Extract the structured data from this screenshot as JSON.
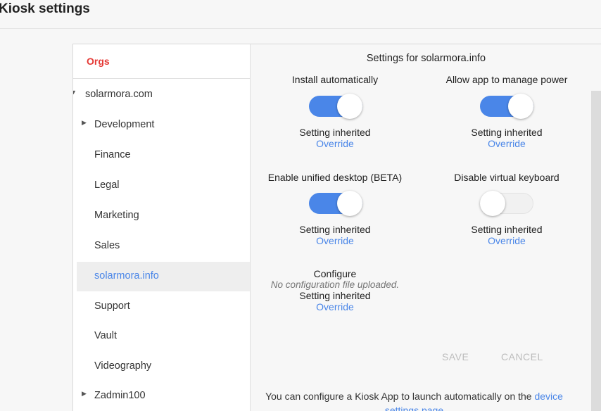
{
  "page": {
    "title": "Kiosk settings"
  },
  "sidebar": {
    "header": "Orgs",
    "items": [
      {
        "label": "solarmora.com",
        "arrow": "▼",
        "depth": 0
      },
      {
        "label": "Development",
        "arrow": "▶",
        "depth": 1
      },
      {
        "label": "Finance",
        "depth": 1
      },
      {
        "label": "Legal",
        "depth": 1
      },
      {
        "label": "Marketing",
        "depth": 1
      },
      {
        "label": "Sales",
        "depth": 1
      },
      {
        "label": "solarmora.info",
        "depth": 1,
        "selected": true
      },
      {
        "label": "Support",
        "depth": 1
      },
      {
        "label": "Vault",
        "depth": 1
      },
      {
        "label": "Videography",
        "depth": 1
      },
      {
        "label": "Zadmin100",
        "arrow": "▶",
        "depth": 1
      }
    ]
  },
  "main": {
    "title": "Settings for solarmora.info",
    "settings": [
      {
        "name": "Install automatically",
        "state": "on",
        "inherited": "Setting inherited",
        "override": "Override"
      },
      {
        "name": "Allow app to manage power",
        "state": "on",
        "inherited": "Setting inherited",
        "override": "Override"
      },
      {
        "name": "Enable unified desktop (BETA)",
        "state": "on",
        "inherited": "Setting inherited",
        "override": "Override"
      },
      {
        "name": "Disable virtual keyboard",
        "state": "off",
        "inherited": "Setting inherited",
        "override": "Override"
      }
    ],
    "configure": {
      "name": "Configure",
      "note": "No configuration file uploaded.",
      "inherited": "Setting inherited",
      "override": "Override"
    },
    "buttons": {
      "save": "SAVE",
      "cancel": "CANCEL"
    },
    "footer": {
      "text": "You can configure a Kiosk App to launch automatically on the",
      "link": "device settings page"
    }
  },
  "colors": {
    "accent": "#4a86e8",
    "orgs_header": "#e53935",
    "disabled_button": "#bdbdbd"
  }
}
